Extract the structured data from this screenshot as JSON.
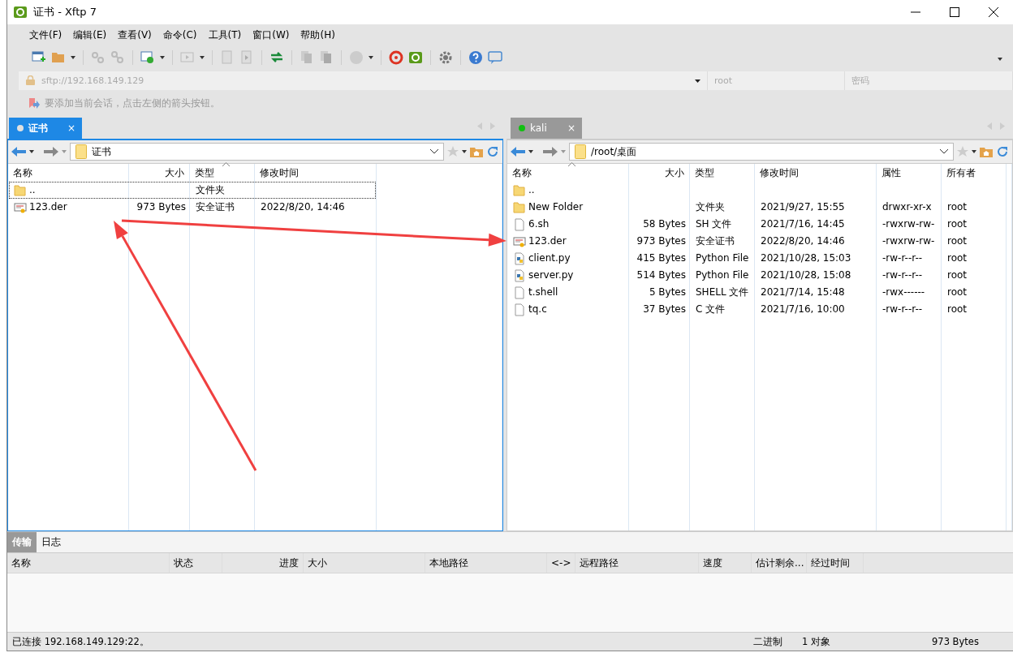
{
  "window": {
    "title": "证书 - Xftp 7"
  },
  "menu": [
    "文件(F)",
    "编辑(E)",
    "查看(V)",
    "命令(C)",
    "工具(T)",
    "窗口(W)",
    "帮助(H)"
  ],
  "address_bar": {
    "url": {
      "placeholder": "sftp://192.168.149.129"
    },
    "user": {
      "placeholder": "root"
    },
    "password": {
      "placeholder": "密码"
    }
  },
  "hint": "要添加当前会话，点击左侧的箭头按钮。",
  "panes": [
    {
      "tab": {
        "label": "证书",
        "selected": true,
        "color": "#e0e0e0",
        "close": "×"
      },
      "path": "证书",
      "columns": [
        {
          "label": "名称",
          "sorted": false
        },
        {
          "label": "大小",
          "sorted": false
        },
        {
          "label": "类型",
          "sorted": true
        },
        {
          "label": "修改时间",
          "sorted": false
        }
      ],
      "rows": [
        {
          "kind": "folder",
          "focused": true,
          "cells": [
            "..",
            "",
            "文件夹",
            ""
          ]
        },
        {
          "kind": "cert",
          "focused": false,
          "cells": [
            "123.der",
            "973 Bytes",
            "安全证书",
            "2022/8/20, 14:46"
          ]
        }
      ]
    },
    {
      "tab": {
        "label": "kali",
        "selected": false,
        "color": "#10c010",
        "close": "×"
      },
      "path": "/root/桌面",
      "columns": [
        {
          "label": "名称",
          "sorted": true
        },
        {
          "label": "大小",
          "sorted": false
        },
        {
          "label": "类型",
          "sorted": false
        },
        {
          "label": "修改时间",
          "sorted": false
        },
        {
          "label": "属性",
          "sorted": false
        },
        {
          "label": "所有者",
          "sorted": false
        }
      ],
      "rows": [
        {
          "kind": "folder",
          "focused": false,
          "cells": [
            "..",
            "",
            "",
            "",
            "",
            ""
          ]
        },
        {
          "kind": "folder",
          "focused": false,
          "cells": [
            "New Folder",
            "",
            "文件夹",
            "2021/9/27, 15:55",
            "drwxr-xr-x",
            "root"
          ]
        },
        {
          "kind": "file",
          "focused": false,
          "cells": [
            "6.sh",
            "58 Bytes",
            "SH 文件",
            "2021/7/16, 14:45",
            "-rwxrw-rw-",
            "root"
          ]
        },
        {
          "kind": "cert",
          "focused": false,
          "cells": [
            "123.der",
            "973 Bytes",
            "安全证书",
            "2022/8/20, 14:46",
            "-rwxrw-rw-",
            "root"
          ]
        },
        {
          "kind": "python",
          "focused": false,
          "cells": [
            "client.py",
            "415 Bytes",
            "Python File",
            "2021/10/28, 15:03",
            "-rw-r--r--",
            "root"
          ]
        },
        {
          "kind": "python",
          "focused": false,
          "cells": [
            "server.py",
            "514 Bytes",
            "Python File",
            "2021/10/28, 15:08",
            "-rw-r--r--",
            "root"
          ]
        },
        {
          "kind": "file",
          "focused": false,
          "cells": [
            "t.shell",
            "5 Bytes",
            "SHELL 文件",
            "2021/7/14, 15:48",
            "-rwx------",
            "root"
          ]
        },
        {
          "kind": "file",
          "focused": false,
          "cells": [
            "tq.c",
            "37 Bytes",
            "C 文件",
            "2021/7/16, 10:00",
            "-rw-r--r--",
            "root"
          ]
        }
      ]
    }
  ],
  "transfer": {
    "tabs": [
      {
        "label": "传输",
        "selected": true
      },
      {
        "label": "日志",
        "selected": false
      }
    ],
    "columns": [
      "名称",
      "状态",
      "进度",
      "大小",
      "本地路径",
      "<->",
      "远程路径",
      "速度",
      "估计剩余...",
      "经过时间"
    ]
  },
  "status_bar": {
    "connection": "已连接 192.168.149.129:22。",
    "mode": "二进制",
    "objects": "1 对象",
    "size": "973 Bytes"
  },
  "annotations": [
    {
      "kind": "arrow"
    },
    {
      "kind": "arrow"
    }
  ]
}
